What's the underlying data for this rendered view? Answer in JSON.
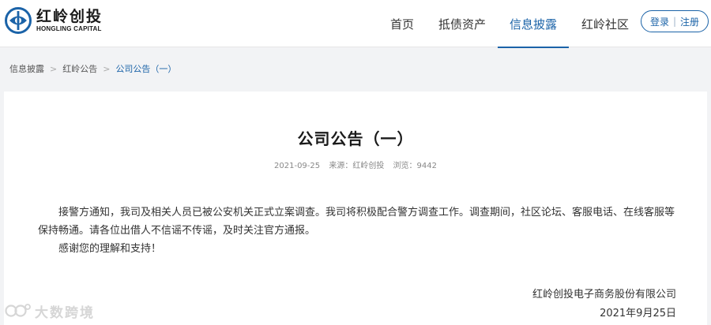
{
  "brand": {
    "name_cn": "红岭创投",
    "name_en": "HONGLING CAPITAL",
    "color": "#1b63a8"
  },
  "nav": {
    "items": [
      {
        "label": "首页",
        "active": false
      },
      {
        "label": "抵债资产",
        "active": false
      },
      {
        "label": "信息披露",
        "active": true
      },
      {
        "label": "红岭社区",
        "active": false
      }
    ]
  },
  "auth": {
    "login_label": "登录",
    "separator": "|",
    "register_label": "注册"
  },
  "breadcrumb": {
    "items": [
      "信息披露",
      "红岭公告",
      "公司公告（一）"
    ],
    "separator": ">"
  },
  "article": {
    "title": "公司公告（一）",
    "date": "2021-09-25",
    "source": "来源：红岭创投",
    "views": "浏览：9442",
    "paragraphs": [
      "接警方通知，我司及相关人员已被公安机关正式立案调查。我司将积极配合警方调查工作。调查期间，社区论坛、客服电话、在线客服等保持畅通。请各位出借人不信谣不传谣，及时关注官方通报。",
      "感谢您的理解和支持！"
    ],
    "signature_company": "红岭创投电子商务股份有限公司",
    "signature_date": "2021年9月25日"
  },
  "watermark": {
    "text": "大数跨境"
  }
}
